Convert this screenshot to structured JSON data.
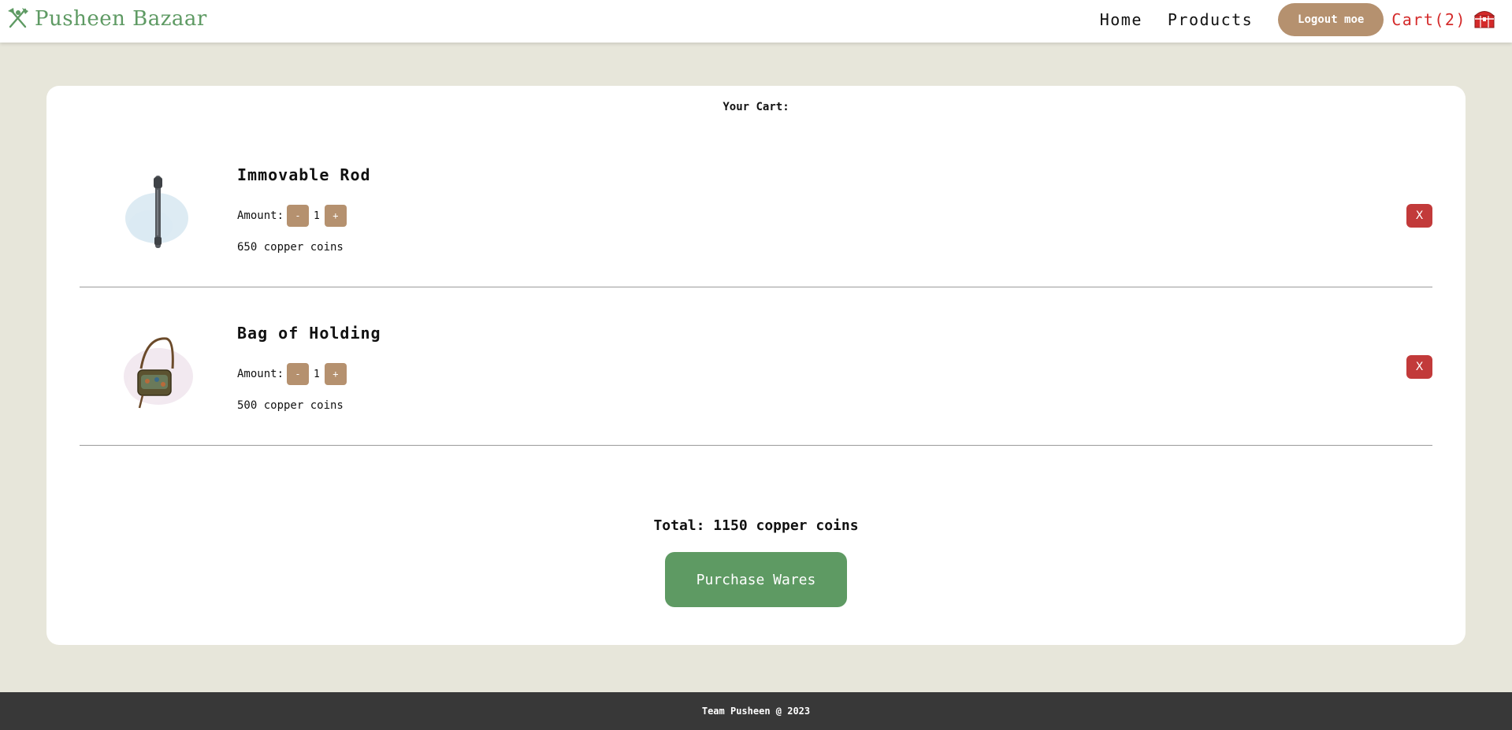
{
  "header": {
    "brand": "Pusheen Bazaar",
    "nav": {
      "home": "Home",
      "products": "Products"
    },
    "logout_label": "Logout moe",
    "cart_label": "Cart(2)"
  },
  "cart": {
    "title": "Your Cart:",
    "amount_label": "Amount:",
    "minus_label": "-",
    "plus_label": "+",
    "remove_label": "X",
    "items": [
      {
        "name": "Immovable Rod",
        "quantity": "1",
        "price": "650 copper coins"
      },
      {
        "name": "Bag of Holding",
        "quantity": "1",
        "price": "500 copper coins"
      }
    ],
    "total": "Total: 1150 copper coins",
    "purchase_label": "Purchase Wares"
  },
  "footer": {
    "text": "Team Pusheen @ 2023"
  },
  "colors": {
    "brand": "#5e9a63",
    "accent": "#b5916f",
    "danger": "#c23a3a",
    "cart_text": "#d42a2a",
    "background": "#e7e6da",
    "footer": "#383838"
  }
}
